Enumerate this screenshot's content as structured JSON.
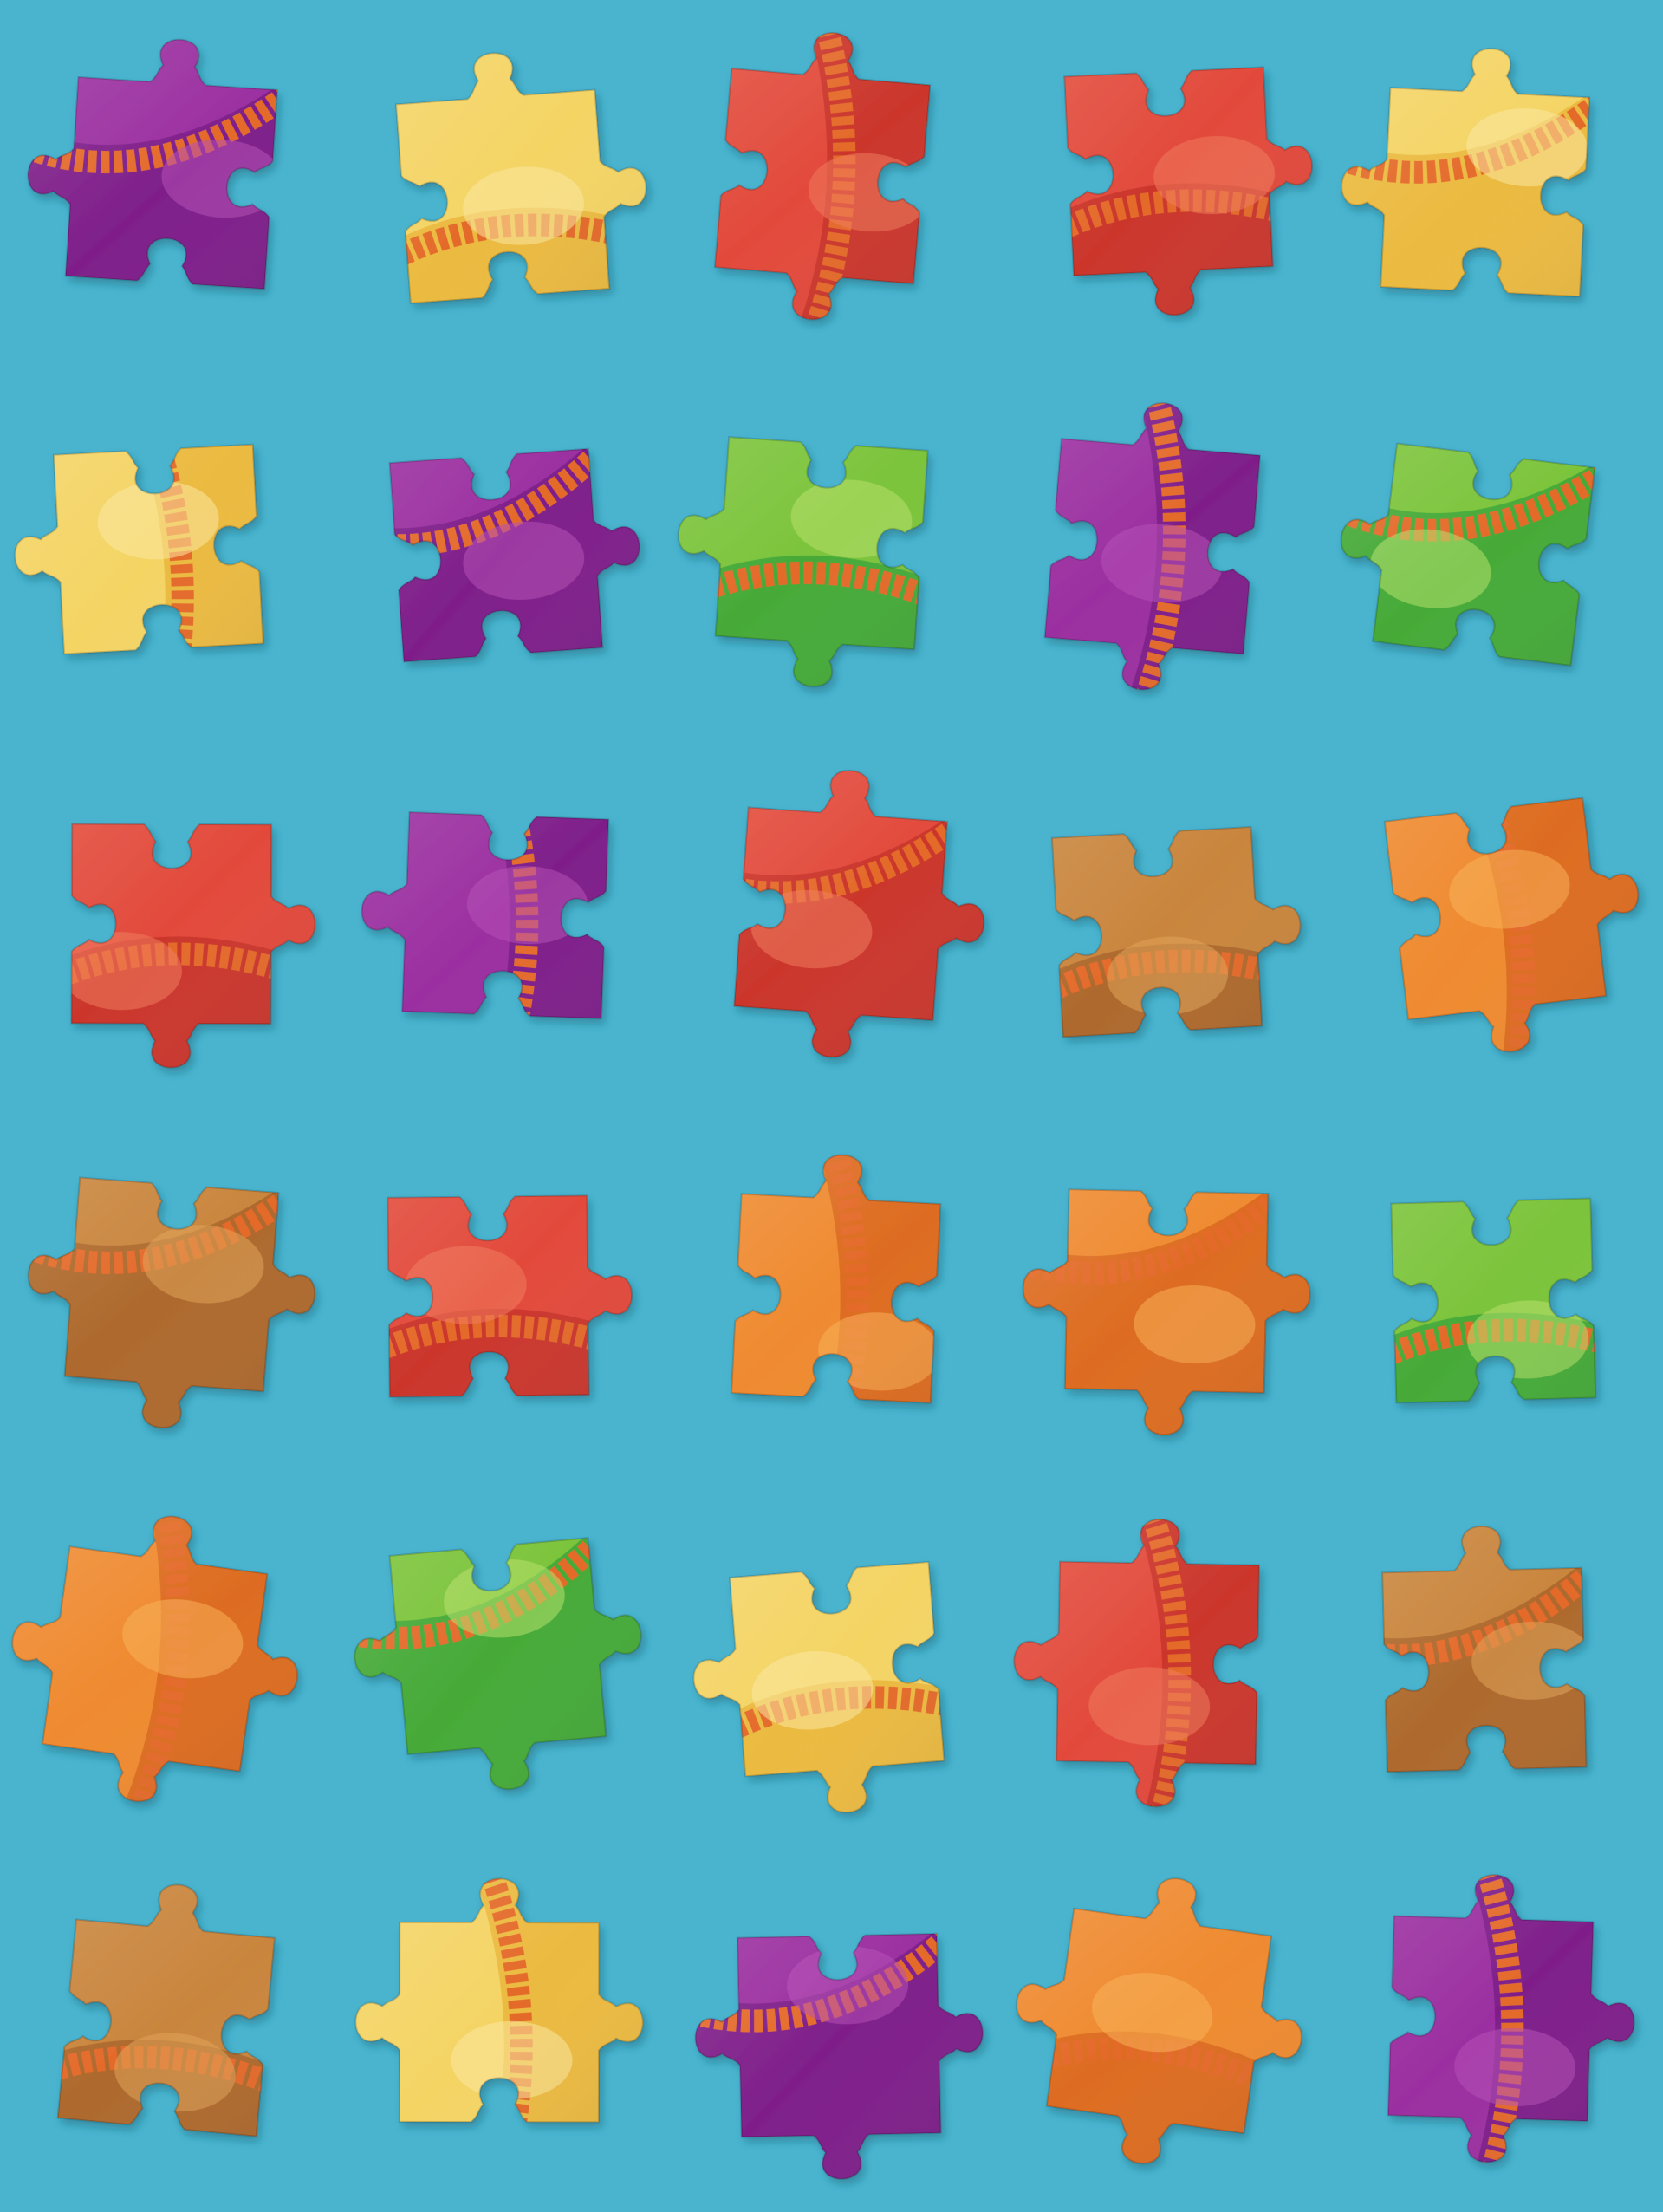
{
  "photo": {
    "subject": "loose-jigsaw-puzzle-pieces",
    "background_color": "#4ab4cf",
    "layout": {
      "rows": 6,
      "columns": 5
    }
  },
  "palette": {
    "purple": [
      "#9b2fa0",
      "#7a1c86",
      "#b44fb6"
    ],
    "yellow": [
      "#f4d464",
      "#e9b53a",
      "#fbe7a0"
    ],
    "red": [
      "#e24a3b",
      "#c7332a",
      "#f07a5c"
    ],
    "orange": [
      "#ef8a30",
      "#d9661f",
      "#f8b055"
    ],
    "green": [
      "#7cc43b",
      "#3da638",
      "#b6e06a"
    ],
    "brown": [
      "#c9853d",
      "#a9652a",
      "#e0a357"
    ],
    "rind": "#e46a2a",
    "dark": "#3b0d3d"
  },
  "pieces": [
    {
      "color": "purple",
      "tabs": [
        "out",
        "in",
        "in",
        "out"
      ],
      "variant": 1
    },
    {
      "color": "yellow",
      "tabs": [
        "out",
        "out",
        "in",
        "in"
      ],
      "variant": 2
    },
    {
      "color": "red",
      "tabs": [
        "out",
        "in",
        "out",
        "in"
      ],
      "variant": 3
    },
    {
      "color": "red",
      "tabs": [
        "in",
        "out",
        "out",
        "in"
      ],
      "variant": 2
    },
    {
      "color": "yellow",
      "tabs": [
        "out",
        "in",
        "in",
        "out"
      ],
      "variant": 1
    },
    {
      "color": "yellow",
      "tabs": [
        "in",
        "in",
        "in",
        "out"
      ],
      "variant": 3
    },
    {
      "color": "purple",
      "tabs": [
        "in",
        "out",
        "in",
        "in"
      ],
      "variant": 1
    },
    {
      "color": "green",
      "tabs": [
        "in",
        "in",
        "out",
        "out"
      ],
      "variant": 2
    },
    {
      "color": "purple",
      "tabs": [
        "out",
        "in",
        "out",
        "in"
      ],
      "variant": 3
    },
    {
      "color": "green",
      "tabs": [
        "in",
        "in",
        "in",
        "out"
      ],
      "variant": 1
    },
    {
      "color": "red",
      "tabs": [
        "in",
        "out",
        "out",
        "in"
      ],
      "variant": 2
    },
    {
      "color": "purple",
      "tabs": [
        "in",
        "in",
        "in",
        "out"
      ],
      "variant": 3
    },
    {
      "color": "red",
      "tabs": [
        "out",
        "out",
        "out",
        "in"
      ],
      "variant": 1
    },
    {
      "color": "brown",
      "tabs": [
        "in",
        "out",
        "in",
        "in"
      ],
      "variant": 2
    },
    {
      "color": "orange",
      "tabs": [
        "in",
        "out",
        "out",
        "in"
      ],
      "variant": 3
    },
    {
      "color": "brown",
      "tabs": [
        "in",
        "out",
        "out",
        "out"
      ],
      "variant": 1
    },
    {
      "color": "red",
      "tabs": [
        "in",
        "out",
        "in",
        "in"
      ],
      "variant": 2
    },
    {
      "color": "orange",
      "tabs": [
        "out",
        "in",
        "in",
        "in"
      ],
      "variant": 3
    },
    {
      "color": "orange",
      "tabs": [
        "in",
        "out",
        "out",
        "out"
      ],
      "variant": 1
    },
    {
      "color": "green",
      "tabs": [
        "in",
        "in",
        "in",
        "in"
      ],
      "variant": 2
    },
    {
      "color": "orange",
      "tabs": [
        "out",
        "out",
        "out",
        "out"
      ],
      "variant": 3
    },
    {
      "color": "green",
      "tabs": [
        "in",
        "out",
        "out",
        "out"
      ],
      "variant": 1
    },
    {
      "color": "yellow",
      "tabs": [
        "in",
        "in",
        "out",
        "out"
      ],
      "variant": 2
    },
    {
      "color": "red",
      "tabs": [
        "out",
        "in",
        "out",
        "out"
      ],
      "variant": 3
    },
    {
      "color": "brown",
      "tabs": [
        "out",
        "in",
        "in",
        "in"
      ],
      "variant": 1
    },
    {
      "color": "brown",
      "tabs": [
        "out",
        "in",
        "in",
        "in"
      ],
      "variant": 2
    },
    {
      "color": "yellow",
      "tabs": [
        "out",
        "out",
        "in",
        "out"
      ],
      "variant": 3
    },
    {
      "color": "purple",
      "tabs": [
        "in",
        "out",
        "out",
        "out"
      ],
      "variant": 1
    },
    {
      "color": "orange",
      "tabs": [
        "out",
        "out",
        "out",
        "out"
      ],
      "variant": 2
    },
    {
      "color": "purple",
      "tabs": [
        "out",
        "out",
        "out",
        "in"
      ],
      "variant": 3
    }
  ]
}
